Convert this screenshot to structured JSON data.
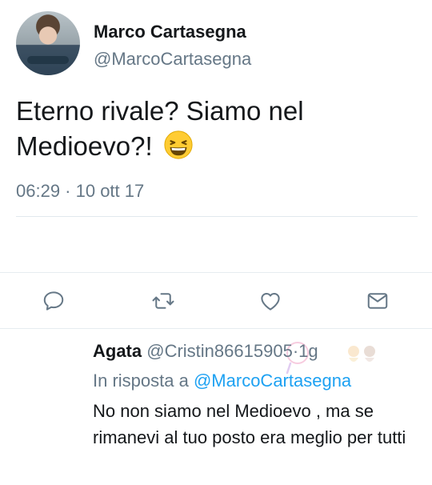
{
  "tweet": {
    "display_name": "Marco Cartasegna",
    "handle": "@MarcoCartasegna",
    "text": "Eterno rivale? Siamo nel Medioevo?!",
    "emoji": "grinning-squinting-face-emoji",
    "timestamp": "06:29 · 10 ott 17"
  },
  "actions": [
    {
      "name": "reply",
      "icon": "comment-icon"
    },
    {
      "name": "retweet",
      "icon": "retweet-icon"
    },
    {
      "name": "like",
      "icon": "heart-icon"
    },
    {
      "name": "share",
      "icon": "mail-icon"
    }
  ],
  "reply": {
    "name": "Agata",
    "handle": "@Cristin86615905",
    "separator": "·",
    "age": "1g",
    "context_prefix": "In risposta a",
    "context_mention": "@MarcoCartasegna",
    "text": "No non siamo nel Medioevo , ma se rimanevi al tuo posto era meglio per tutti"
  },
  "colors": {
    "text": "#14171a",
    "secondary": "#657786",
    "link": "#1da1f2",
    "divider": "#e6ecf0",
    "emoji": "#ffcc33"
  }
}
